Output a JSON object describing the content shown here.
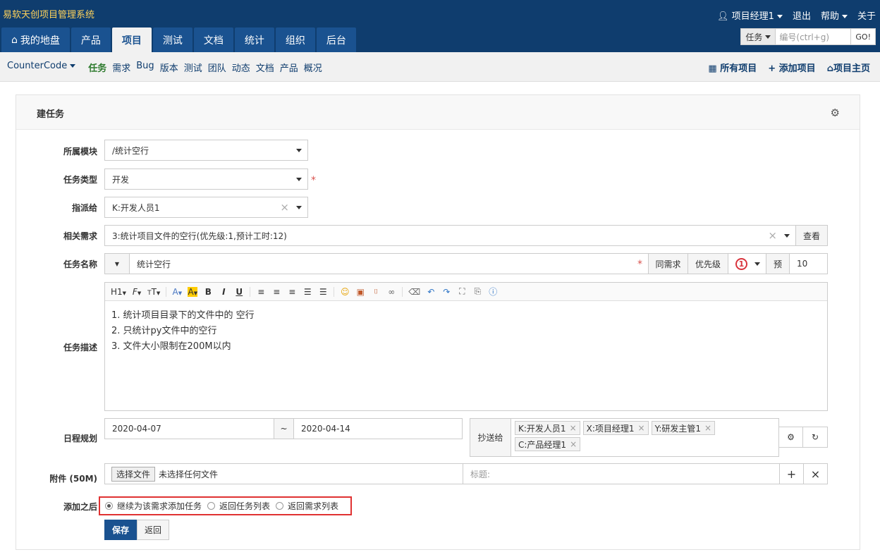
{
  "header": {
    "brand": "易软天创项目管理系统",
    "user": "项目经理1",
    "logout": "退出",
    "help": "帮助",
    "about": "关于",
    "search_type": "任务",
    "search_placeholder": "编号(ctrl+g)",
    "search_go": "GO!"
  },
  "mainnav": [
    "我的地盘",
    "产品",
    "项目",
    "测试",
    "文档",
    "统计",
    "组织",
    "后台"
  ],
  "subnav": {
    "crumb": "CounterCode",
    "items": [
      "任务",
      "需求",
      "Bug",
      "版本",
      "测试",
      "团队",
      "动态",
      "文档",
      "产品",
      "概况"
    ],
    "right": [
      "所有项目",
      "添加项目",
      "项目主页"
    ]
  },
  "form": {
    "title": "建任务",
    "module_label": "所属模块",
    "module_value": "/统计空行",
    "type_label": "任务类型",
    "type_value": "开发",
    "assign_label": "指派给",
    "assign_value": "K:开发人员1",
    "story_label": "相关需求",
    "story_value": "3:统计项目文件的空行(优先级:1,预计工时:12)",
    "story_view": "查看",
    "name_label": "任务名称",
    "name_value": "统计空行",
    "same_story": "同需求",
    "priority_label": "优先级",
    "priority_value": "1",
    "estimate_label": "预",
    "estimate_value": "10",
    "desc_label": "任务描述",
    "desc_lines": [
      "1. 统计项目目录下的文件中的 空行",
      "2. 只统计py文件中的空行",
      "3. 文件大小限制在200M以内"
    ],
    "schedule_label": "日程规划",
    "start_date": "2020-04-07",
    "date_sep": "~",
    "end_date": "2020-04-14",
    "cc_label": "抄送给",
    "cc_tags": [
      "K:开发人员1",
      "X:项目经理1",
      "Y:研发主管1",
      "C:产品经理1"
    ],
    "attach_label": "附件 (50M)",
    "choose_file": "选择文件",
    "no_file": "未选择任何文件",
    "caption_placeholder": "标题:",
    "after_label": "添加之后",
    "after_options": [
      "继续为该需求添加任务",
      "返回任务列表",
      "返回需求列表"
    ],
    "save": "保存",
    "back": "返回"
  },
  "toolbar": [
    "H1",
    "F",
    "T",
    "A",
    "A",
    "B",
    "I",
    "U"
  ]
}
